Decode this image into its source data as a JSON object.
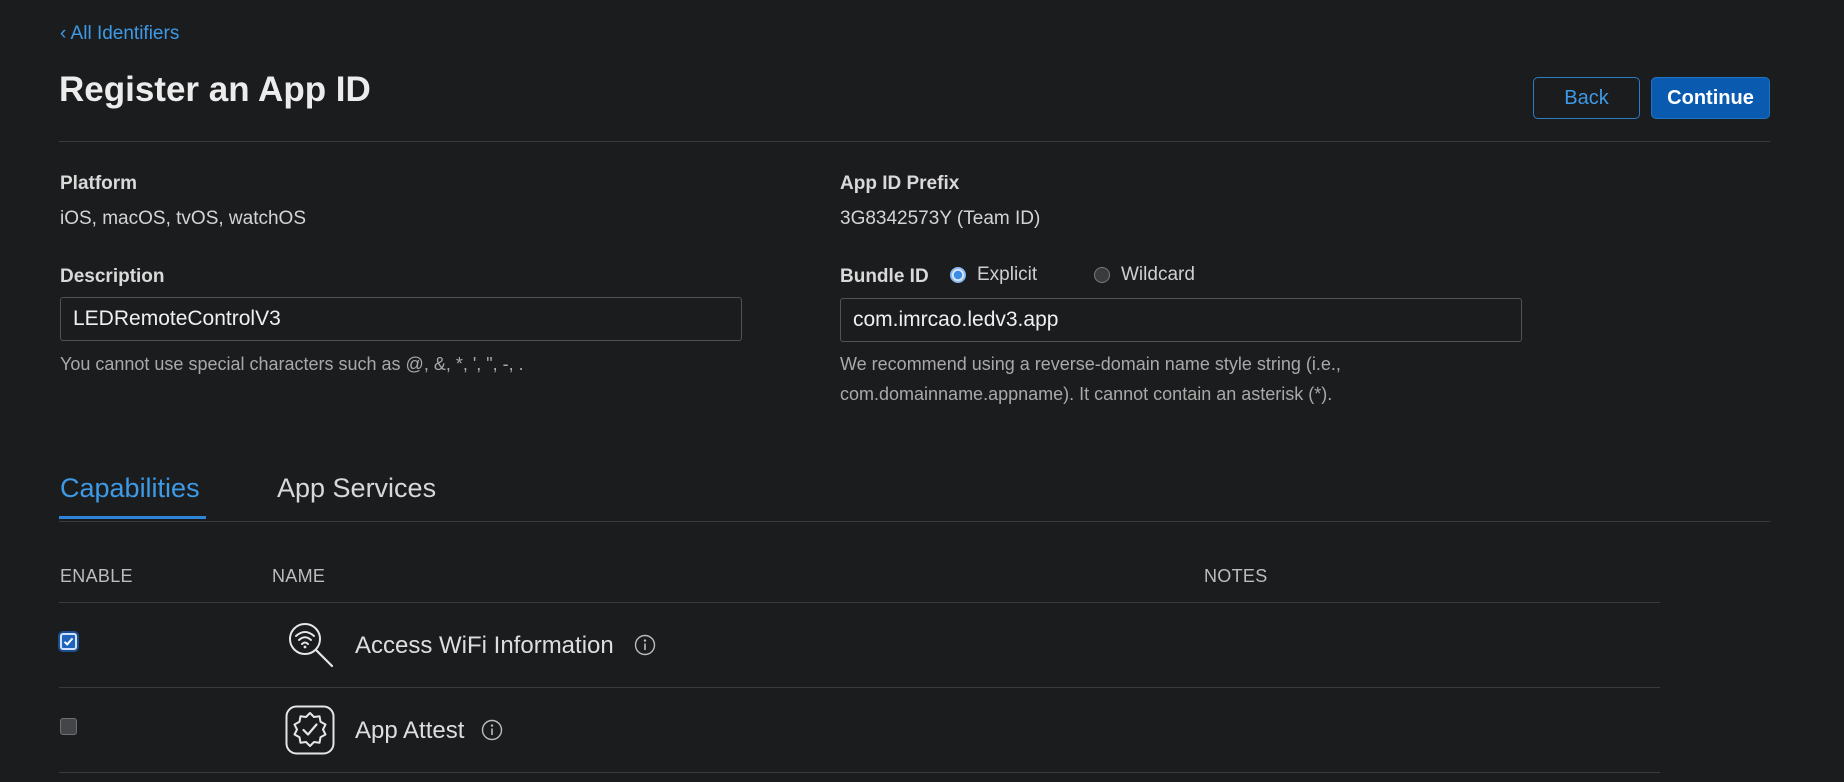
{
  "nav": {
    "back_link": "‹ All Identifiers"
  },
  "header": {
    "title": "Register an App ID",
    "back_label": "Back",
    "continue_label": "Continue"
  },
  "form": {
    "platform_label": "Platform",
    "platform_value": "iOS, macOS, tvOS, watchOS",
    "prefix_label": "App ID Prefix",
    "prefix_value": "3G8342573Y (Team ID)",
    "description_label": "Description",
    "description_value": "LEDRemoteControlV3",
    "description_help": "You cannot use special characters such as @, &, *, ', \", -, .",
    "bundle_label": "Bundle ID",
    "bundle_options": [
      "Explicit",
      "Wildcard"
    ],
    "bundle_selected": "Explicit",
    "bundle_value": "com.imrcao.ledv3.app",
    "bundle_help_line1": "We recommend using a reverse-domain name style string (i.e.,",
    "bundle_help_line2": "com.domainname.appname). It cannot contain an asterisk (*)."
  },
  "tabs": {
    "items": [
      "Capabilities",
      "App Services"
    ],
    "active": "Capabilities"
  },
  "table": {
    "columns": [
      "ENABLE",
      "NAME",
      "NOTES"
    ],
    "rows": [
      {
        "name": "Access WiFi Information",
        "enabled": true,
        "icon": "wifi-search-icon"
      },
      {
        "name": "App Attest",
        "enabled": false,
        "icon": "app-attest-badge-icon"
      }
    ]
  },
  "colors": {
    "background": "#1b1c1e",
    "accent": "#3e9ae6",
    "primary_button": "#0a5bb0"
  }
}
